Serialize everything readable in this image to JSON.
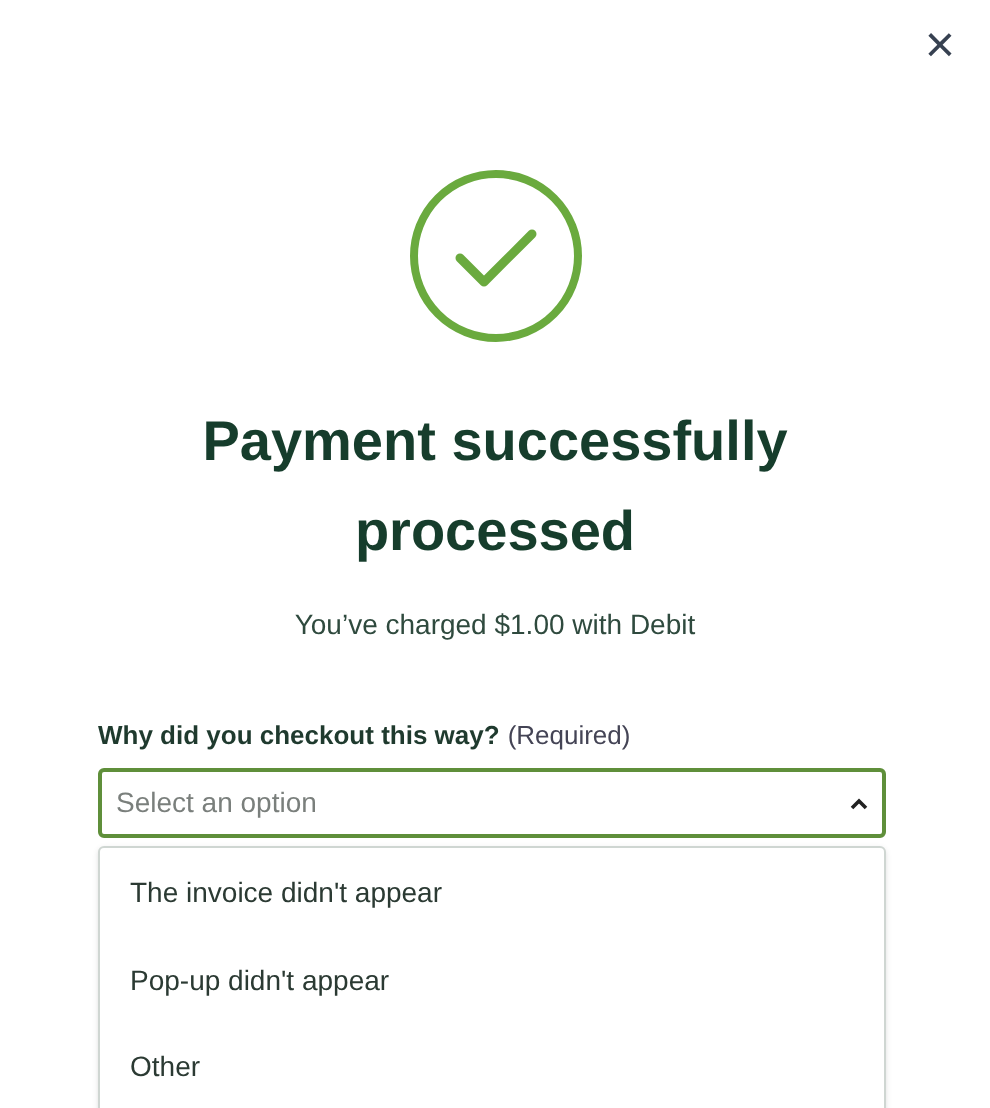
{
  "close_button": {
    "label": "×"
  },
  "title": "Payment successfully processed",
  "subtitle": "You’ve charged $1.00 with Debit",
  "field": {
    "label": "Why did you checkout this way?",
    "required_note": "(Required)",
    "placeholder": "Select an option",
    "expanded": true,
    "options": [
      {
        "label": "The invoice didn't appear"
      },
      {
        "label": "Pop-up didn't appear"
      },
      {
        "label": "Other"
      }
    ]
  }
}
